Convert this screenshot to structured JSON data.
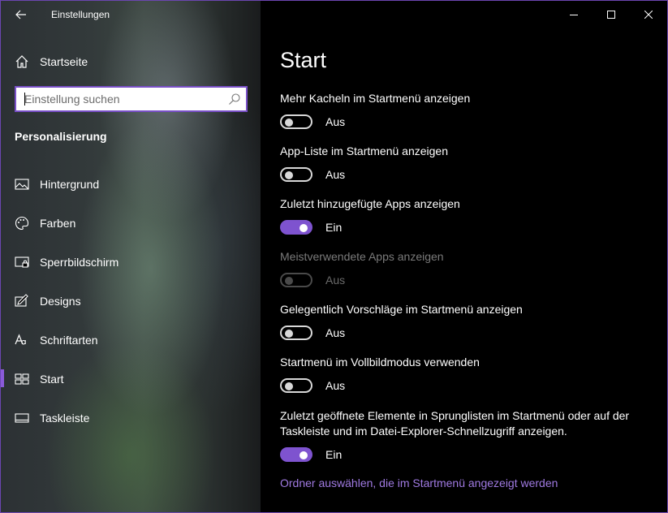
{
  "window": {
    "title": "Einstellungen",
    "accent_color": "#7e53cf"
  },
  "sidebar": {
    "home_label": "Startseite",
    "search": {
      "placeholder": "Einstellung suchen",
      "value": ""
    },
    "section_heading": "Personalisierung",
    "items": [
      {
        "label": "Hintergrund",
        "icon": "picture-icon",
        "selected": false
      },
      {
        "label": "Farben",
        "icon": "palette-icon",
        "selected": false
      },
      {
        "label": "Sperrbildschirm",
        "icon": "lock-screen-icon",
        "selected": false
      },
      {
        "label": "Designs",
        "icon": "brush-icon",
        "selected": false
      },
      {
        "label": "Schriftarten",
        "icon": "fonts-icon",
        "selected": false
      },
      {
        "label": "Start",
        "icon": "start-icon",
        "selected": true
      },
      {
        "label": "Taskleiste",
        "icon": "taskbar-icon",
        "selected": false
      }
    ]
  },
  "main": {
    "title": "Start",
    "settings": [
      {
        "title": "Mehr Kacheln im Startmenü anzeigen",
        "state": "Aus",
        "on": false,
        "disabled": false
      },
      {
        "title": "App-Liste im Startmenü anzeigen",
        "state": "Aus",
        "on": false,
        "disabled": false
      },
      {
        "title": "Zuletzt hinzugefügte Apps anzeigen",
        "state": "Ein",
        "on": true,
        "disabled": false
      },
      {
        "title": "Meistverwendete Apps anzeigen",
        "state": "Aus",
        "on": false,
        "disabled": true
      },
      {
        "title": "Gelegentlich Vorschläge im Startmenü anzeigen",
        "state": "Aus",
        "on": false,
        "disabled": false
      },
      {
        "title": "Startmenü im Vollbildmodus verwenden",
        "state": "Aus",
        "on": false,
        "disabled": false
      },
      {
        "title": "Zuletzt geöffnete Elemente in Sprunglisten im Startmenü oder auf der Taskleiste und im Datei-Explorer-Schnellzugriff anzeigen.",
        "state": "Ein",
        "on": true,
        "disabled": false
      }
    ],
    "link": "Ordner auswählen, die im Startmenü angezeigt werden"
  }
}
